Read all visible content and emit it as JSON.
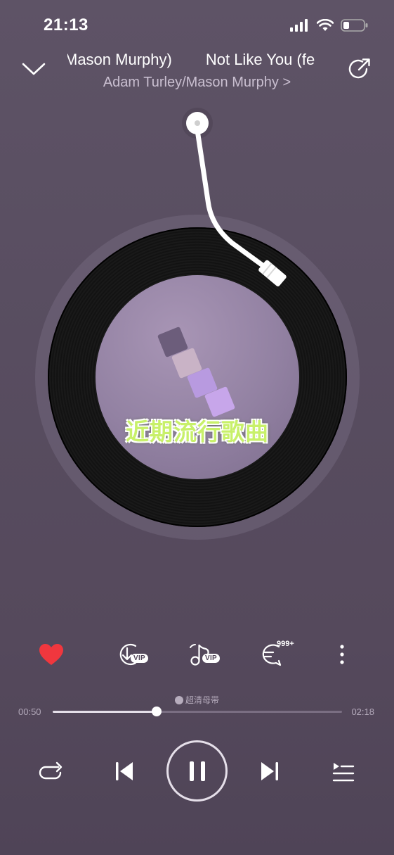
{
  "status_bar": {
    "time": "21:13",
    "icons": [
      "signal-icon",
      "wifi-icon",
      "battery-icon"
    ]
  },
  "header": {
    "title_left": "Mason Murphy)",
    "title_right": "Not Like You (fe",
    "artist": "Adam Turley/Mason Murphy",
    "artist_chevron": ">"
  },
  "cover": {
    "overlay_text": "近期流行歌曲"
  },
  "actions": {
    "like": "heart-icon",
    "download_badge": "VIP",
    "ringtone_badge": "VIP",
    "comment_count": "999+",
    "more": "more-vertical-icon"
  },
  "progress": {
    "quality_label": "超清母带",
    "current": "00:50",
    "total": "02:18",
    "fraction": 0.36
  },
  "controls": {
    "repeat": "repeat-icon",
    "prev": "previous-icon",
    "pause": "pause-icon",
    "next": "next-icon",
    "playlist": "playlist-icon"
  },
  "colors": {
    "like": "#f0373e",
    "accent_text": "#c8f06a",
    "background": "#584d60"
  }
}
